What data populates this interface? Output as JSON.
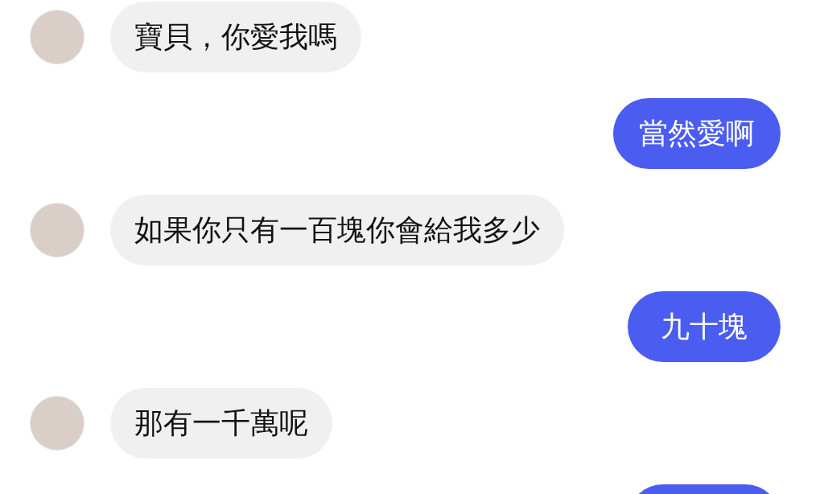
{
  "messages": [
    {
      "kind": "incoming",
      "text": "寶貝，你愛我嗎"
    },
    {
      "kind": "outgoing",
      "text": "當然愛啊"
    },
    {
      "kind": "incoming",
      "text": "如果你只有一百塊你會給我多少"
    },
    {
      "kind": "outgoing",
      "text": "九十塊"
    },
    {
      "kind": "incoming",
      "text": "那有一千萬呢"
    },
    {
      "kind": "outgoing"
    }
  ]
}
